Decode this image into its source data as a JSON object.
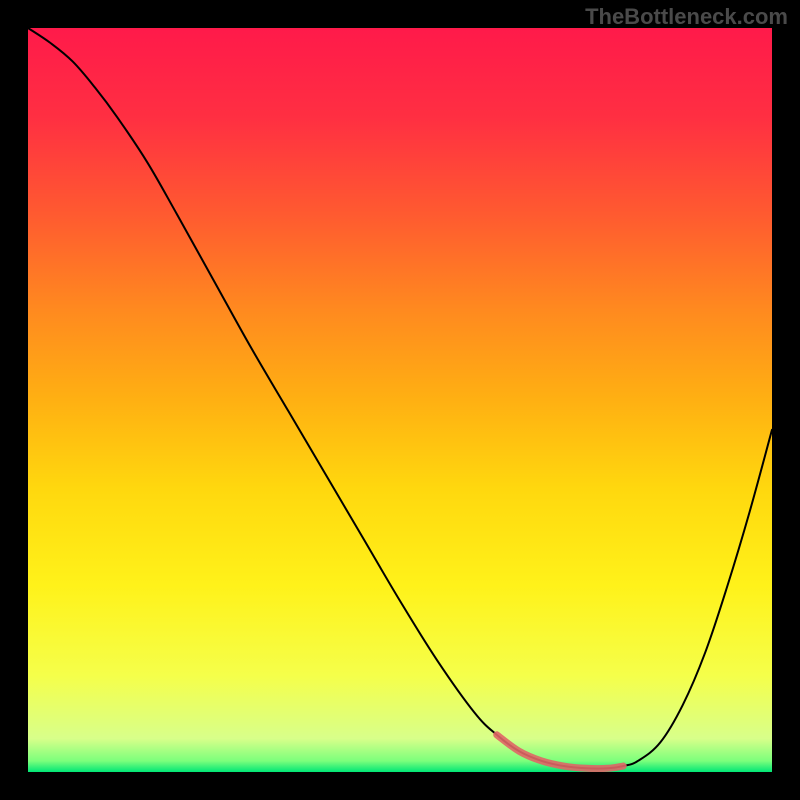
{
  "watermark": "TheBottleneck.com",
  "chart_data": {
    "type": "line",
    "title": "",
    "xlabel": "",
    "ylabel": "",
    "xlim": [
      0,
      100
    ],
    "ylim": [
      0,
      100
    ],
    "background_gradient": {
      "stops": [
        {
          "offset": 0.0,
          "color": "#ff1a4a"
        },
        {
          "offset": 0.12,
          "color": "#ff2f42"
        },
        {
          "offset": 0.25,
          "color": "#ff5a30"
        },
        {
          "offset": 0.38,
          "color": "#ff8a1f"
        },
        {
          "offset": 0.5,
          "color": "#ffb012"
        },
        {
          "offset": 0.62,
          "color": "#ffd80e"
        },
        {
          "offset": 0.75,
          "color": "#fff21a"
        },
        {
          "offset": 0.87,
          "color": "#f5ff4a"
        },
        {
          "offset": 0.955,
          "color": "#d8ff8a"
        },
        {
          "offset": 0.985,
          "color": "#7cff7c"
        },
        {
          "offset": 1.0,
          "color": "#00e676"
        }
      ]
    },
    "series": [
      {
        "name": "bottleneck_curve",
        "color": "#000000",
        "width": 2,
        "x": [
          0,
          3,
          6,
          9,
          12,
          16,
          20,
          25,
          30,
          35,
          40,
          45,
          50,
          55,
          60,
          63,
          66,
          69,
          72,
          75,
          78,
          80,
          82,
          85,
          88,
          91,
          94,
          97,
          100
        ],
        "y": [
          100,
          98,
          95.5,
          92,
          88,
          82,
          75,
          66,
          57,
          48.5,
          40,
          31.5,
          23,
          15,
          8,
          5,
          2.8,
          1.5,
          0.8,
          0.5,
          0.5,
          0.8,
          1.5,
          4,
          9,
          16,
          25,
          35,
          46
        ]
      }
    ],
    "highlight": {
      "name": "optimal_range",
      "color": "#e06666",
      "width": 7,
      "x": [
        63,
        66,
        69,
        72,
        75,
        78,
        80
      ],
      "y": [
        5,
        2.8,
        1.5,
        0.8,
        0.5,
        0.5,
        0.8
      ]
    }
  }
}
